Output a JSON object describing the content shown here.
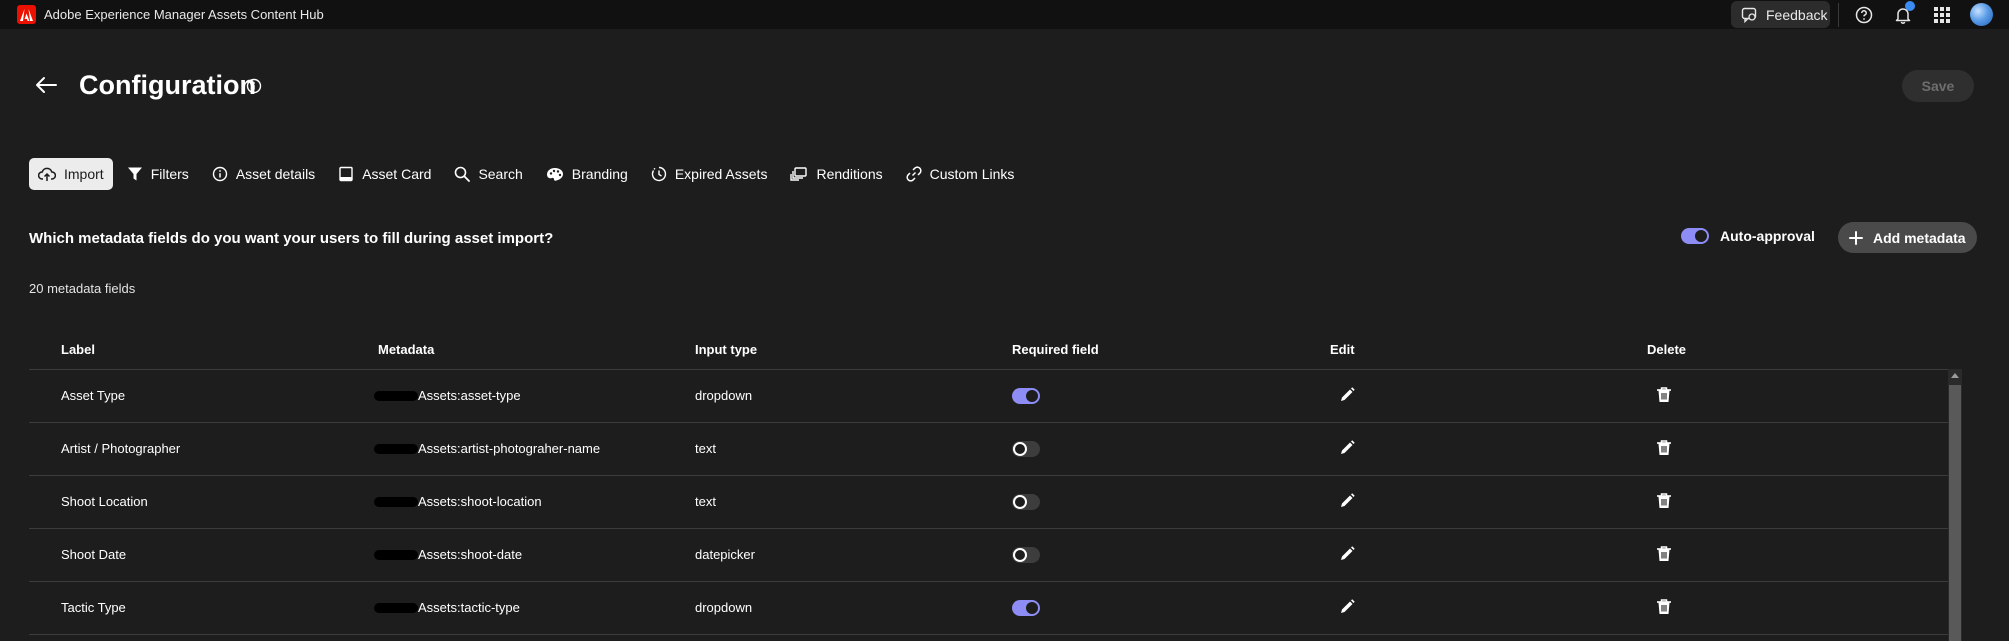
{
  "topbar": {
    "app_title": "Adobe Experience Manager Assets Content Hub",
    "feedback_label": "Feedback"
  },
  "header": {
    "title": "Configuration",
    "save_label": "Save"
  },
  "tabs": [
    {
      "label": "Import",
      "icon": "cloud-upload-icon",
      "active": true
    },
    {
      "label": "Filters",
      "icon": "filter-icon",
      "active": false
    },
    {
      "label": "Asset details",
      "icon": "info-icon",
      "active": false
    },
    {
      "label": "Asset Card",
      "icon": "card-icon",
      "active": false
    },
    {
      "label": "Search",
      "icon": "search-icon",
      "active": false
    },
    {
      "label": "Branding",
      "icon": "palette-icon",
      "active": false
    },
    {
      "label": "Expired Assets",
      "icon": "clock-icon",
      "active": false
    },
    {
      "label": "Renditions",
      "icon": "renditions-icon",
      "active": false
    },
    {
      "label": "Custom Links",
      "icon": "link-icon",
      "active": false
    }
  ],
  "import": {
    "question": "Which metadata fields do you want your users to fill during asset import?",
    "auto_approval_label": "Auto-approval",
    "auto_approval_on": true,
    "add_metadata_label": "Add metadata",
    "count_label": "20 metadata fields"
  },
  "table": {
    "columns": [
      "Label",
      "Metadata",
      "Input type",
      "Required field",
      "Edit",
      "Delete"
    ],
    "rows": [
      {
        "label": "Asset Type",
        "metadata": "Assets:asset-type",
        "input_type": "dropdown",
        "required": true
      },
      {
        "label": "Artist / Photographer",
        "metadata": "Assets:artist-photograher-name",
        "input_type": "text",
        "required": false
      },
      {
        "label": "Shoot Location",
        "metadata": "Assets:shoot-location",
        "input_type": "text",
        "required": false
      },
      {
        "label": "Shoot Date",
        "metadata": "Assets:shoot-date",
        "input_type": "datepicker",
        "required": false
      },
      {
        "label": "Tactic Type",
        "metadata": "Assets:tactic-type",
        "input_type": "dropdown",
        "required": true
      }
    ]
  },
  "colors": {
    "background": "#1d1d1d",
    "topbar": "#111111",
    "toggle_on": "#8d8df5",
    "adobe_red": "#eb1000",
    "notification": "#3b8cf2"
  }
}
